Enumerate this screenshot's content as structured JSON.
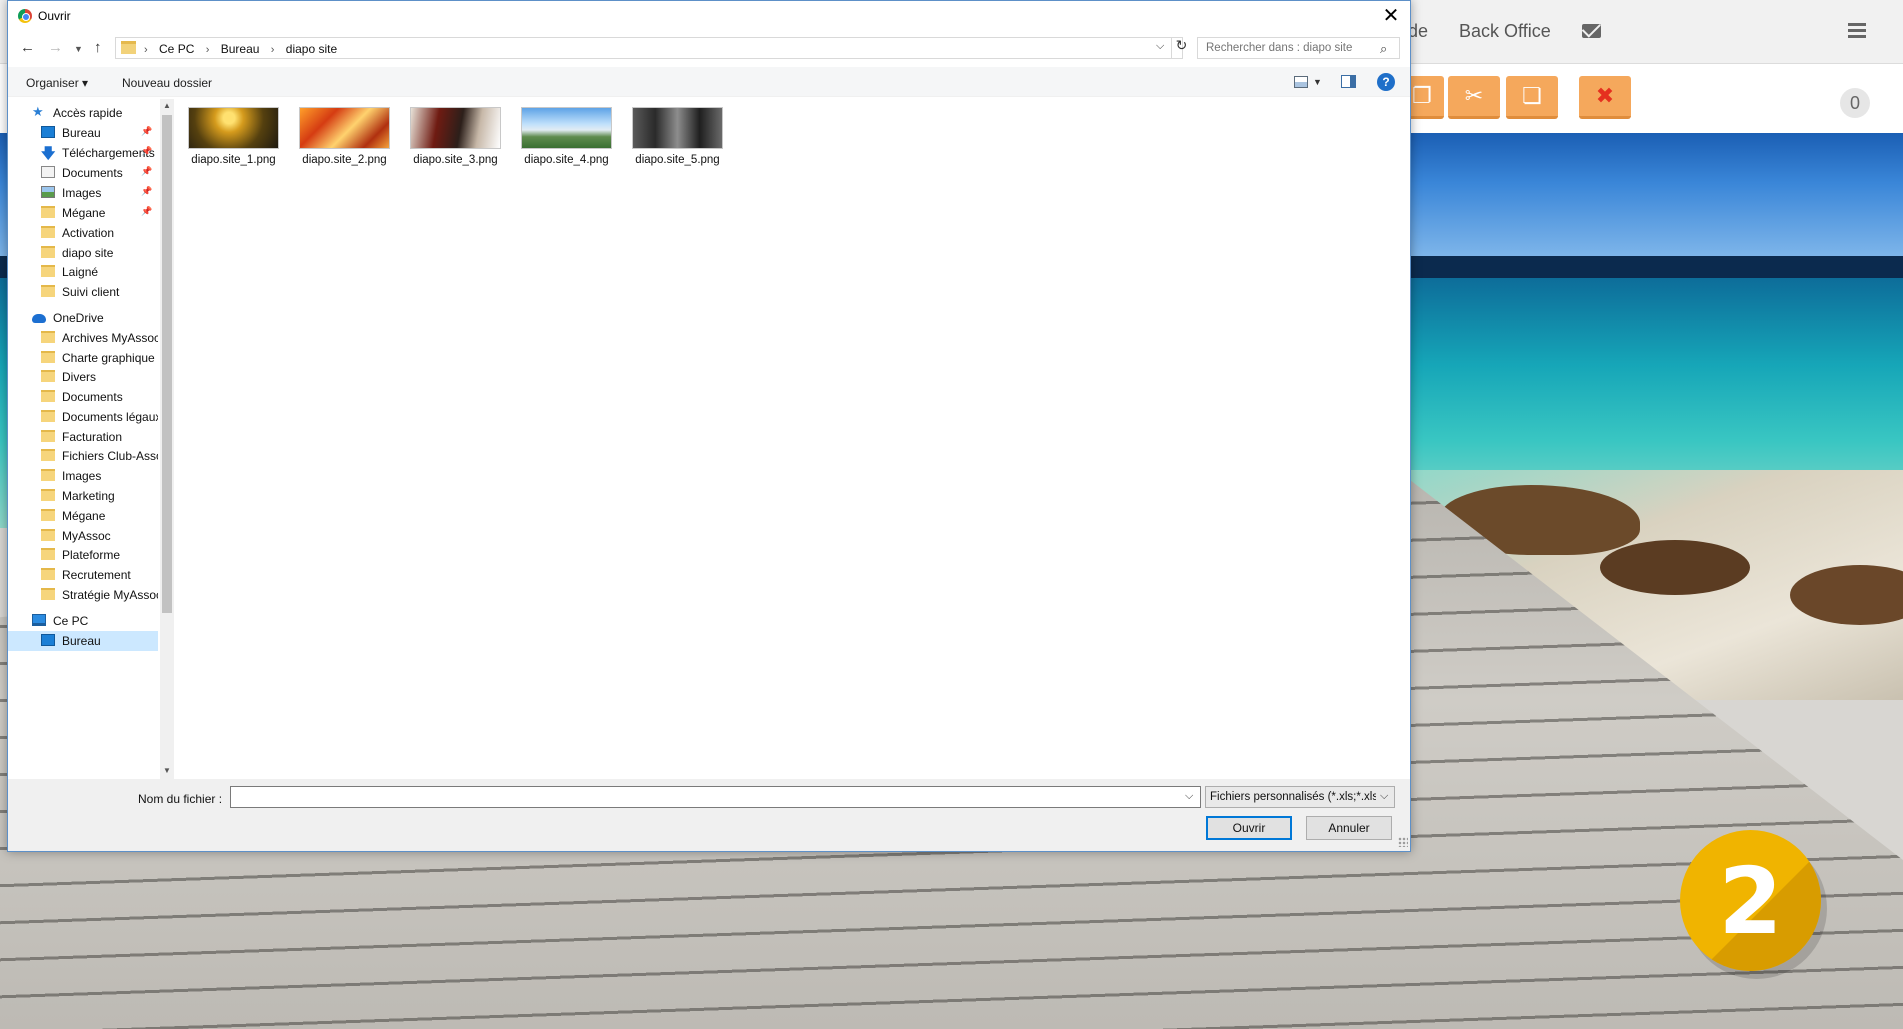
{
  "background_page": {
    "nav": {
      "partial_label": "de",
      "back_office_label": "Back Office"
    },
    "toolbar": {
      "counter": "0"
    },
    "step_badge": "2",
    "colors": {
      "toolbar_button": "#f5a85c",
      "delete_icon": "#e5301f",
      "badge": "#f0b400"
    }
  },
  "dialog": {
    "title": "Ouvrir",
    "address": {
      "crumbs": [
        "Ce PC",
        "Bureau",
        "diapo site"
      ],
      "search_placeholder": "Rechercher dans : diapo site"
    },
    "commands": {
      "organize": "Organiser ▾",
      "new_folder": "Nouveau dossier"
    },
    "nav_tree": {
      "quick_access": {
        "label": "Accès rapide",
        "items": [
          "Bureau",
          "Téléchargements",
          "Documents",
          "Images",
          "Mégane",
          "Activation",
          "diapo site",
          "Laigné",
          "Suivi client"
        ]
      },
      "onedrive": {
        "label": "OneDrive",
        "items": [
          "Archives MyAssoc",
          "Charte graphique",
          "Divers",
          "Documents",
          "Documents légaux",
          "Facturation",
          "Fichiers Club-Asso",
          "Images",
          "Marketing",
          "Mégane",
          "MyAssoc",
          "Plateforme",
          "Recrutement",
          "Stratégie MyAssoc"
        ]
      },
      "this_pc": {
        "label": "Ce PC",
        "items": [
          "Bureau"
        ]
      }
    },
    "files": [
      "diapo.site_1.png",
      "diapo.site_2.png",
      "diapo.site_3.png",
      "diapo.site_4.png",
      "diapo.site_5.png"
    ],
    "bottom": {
      "filename_label": "Nom du fichier :",
      "filename_value": "",
      "filetype": "Fichiers personnalisés (*.xls;*.xlsx)",
      "open_label": "Ouvrir",
      "cancel_label": "Annuler"
    }
  }
}
